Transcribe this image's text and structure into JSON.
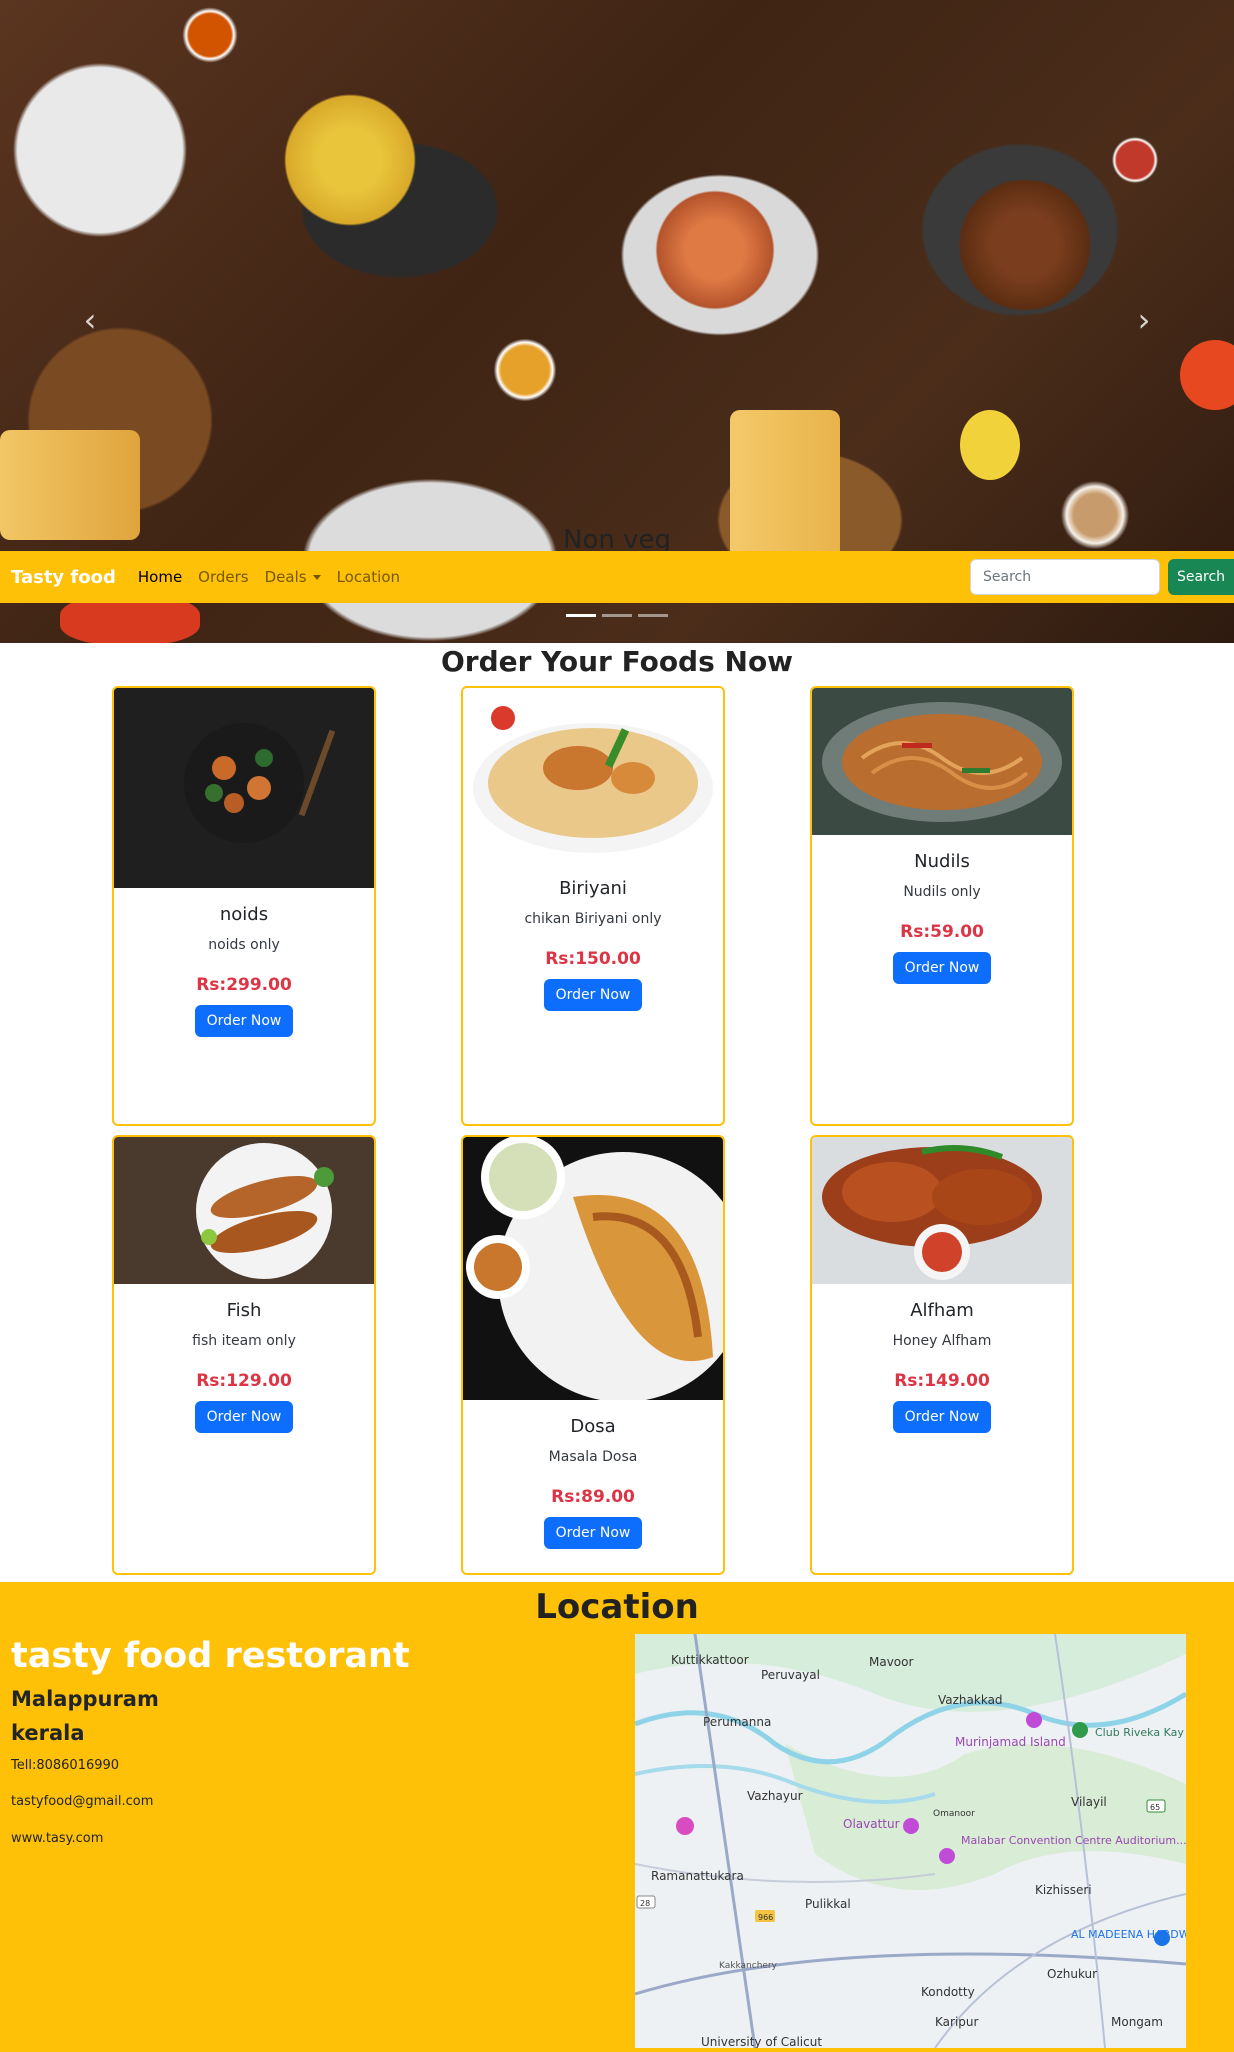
{
  "hero": {
    "caption": "Non veg"
  },
  "navbar": {
    "brand": "Tasty food",
    "links": [
      "Home",
      "Orders",
      "Deals",
      "Location"
    ],
    "search_placeholder": "Search",
    "search_button": "Search"
  },
  "menu": {
    "title": "Order Your Foods Now",
    "order_label": "Order Now",
    "items": [
      {
        "name": "noids",
        "desc": "noids only",
        "price": "Rs:299.00"
      },
      {
        "name": "Biriyani",
        "desc": "chikan Biriyani only",
        "price": "Rs:150.00"
      },
      {
        "name": "Nudils",
        "desc": "Nudils only",
        "price": "Rs:59.00"
      },
      {
        "name": "Fish",
        "desc": "fish iteam only",
        "price": "Rs:129.00"
      },
      {
        "name": "Dosa",
        "desc": "Masala Dosa",
        "price": "Rs:89.00"
      },
      {
        "name": "Alfham",
        "desc": "Honey Alfham",
        "price": "Rs:149.00"
      }
    ]
  },
  "location": {
    "heading": "Location",
    "restaurant_name": "tasty food restorant",
    "city": "Malappuram",
    "state": "kerala",
    "phone": "Tell:8086016990",
    "email": "tastyfood@gmail.com",
    "website": "www.tasy.com"
  },
  "map": {
    "places": [
      "Kuttikkattoor",
      "Peruvayal",
      "Mavoor",
      "Vazhakkad",
      "Perumanna",
      "Murinjamad Island",
      "Club Riveka Kay",
      "Vazhayur",
      "Olavattur",
      "Omanoor",
      "Vilayil",
      "Malabar Convention Centre Auditorium...",
      "Ramanattukara",
      "Pulikkal",
      "Kizhisseri",
      "AL MADEENA HARDWARES",
      "Kakkanchery",
      "Kondotty",
      "Ozhukur",
      "Karipur",
      "Mongam",
      "University of Calicut"
    ],
    "road_labels": [
      "966",
      "28",
      "65"
    ]
  }
}
